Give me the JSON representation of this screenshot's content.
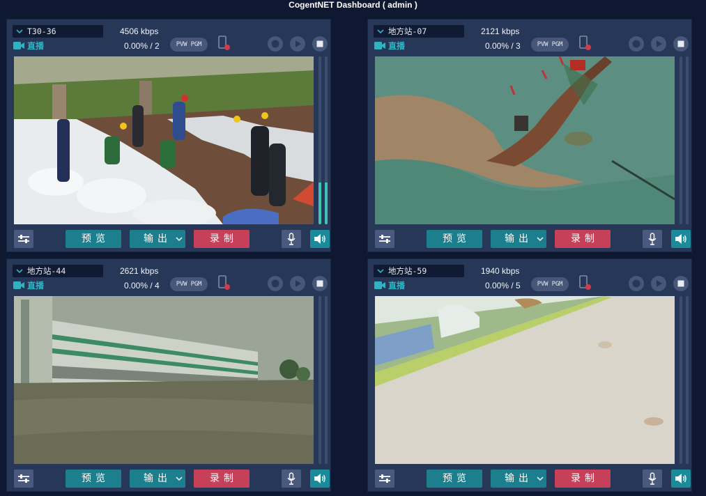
{
  "app": {
    "title": "CogentNET Dashboard ( admin )"
  },
  "panels": [
    {
      "source": "T30-36",
      "live": "直播",
      "bitrate": "4506 kbps",
      "loss": "0.00% / 2",
      "pvw_pgm": "PVW PGM",
      "buttons": {
        "preview": "预览",
        "output": "输出",
        "record": "录制"
      },
      "meter_level": 0.25
    },
    {
      "source": "地方站-07",
      "live": "直播",
      "bitrate": "2121 kbps",
      "loss": "0.00% / 3",
      "pvw_pgm": "PVW PGM",
      "buttons": {
        "preview": "预览",
        "output": "输出",
        "record": "录制"
      },
      "meter_level": 0
    },
    {
      "source": "地方站-44",
      "live": "直播",
      "bitrate": "2621 kbps",
      "loss": "0.00% / 4",
      "pvw_pgm": "PVW PGM",
      "buttons": {
        "preview": "预览",
        "output": "输出",
        "record": "录制"
      },
      "meter_level": 0
    },
    {
      "source": "地方站-59",
      "live": "直播",
      "bitrate": "1940 kbps",
      "loss": "0.00% / 5",
      "pvw_pgm": "PVW PGM",
      "buttons": {
        "preview": "预览",
        "output": "输出",
        "record": "录制"
      },
      "meter_level": 0
    }
  ],
  "icons": {
    "live": "video-camera-icon",
    "source_dropdown": "chevron-down-icon",
    "phone": "phone-alert-icon",
    "record": "record-icon",
    "play": "play-icon",
    "stop": "stop-icon",
    "mixer": "sliders-icon",
    "mic": "microphone-icon",
    "speaker": "speaker-icon"
  },
  "colors": {
    "accent": "#1d7f8e",
    "record": "#c6405a",
    "live": "#2fb3c3",
    "meter": "#3ec3b4",
    "background": "#0e1830",
    "panel": "#263758"
  }
}
